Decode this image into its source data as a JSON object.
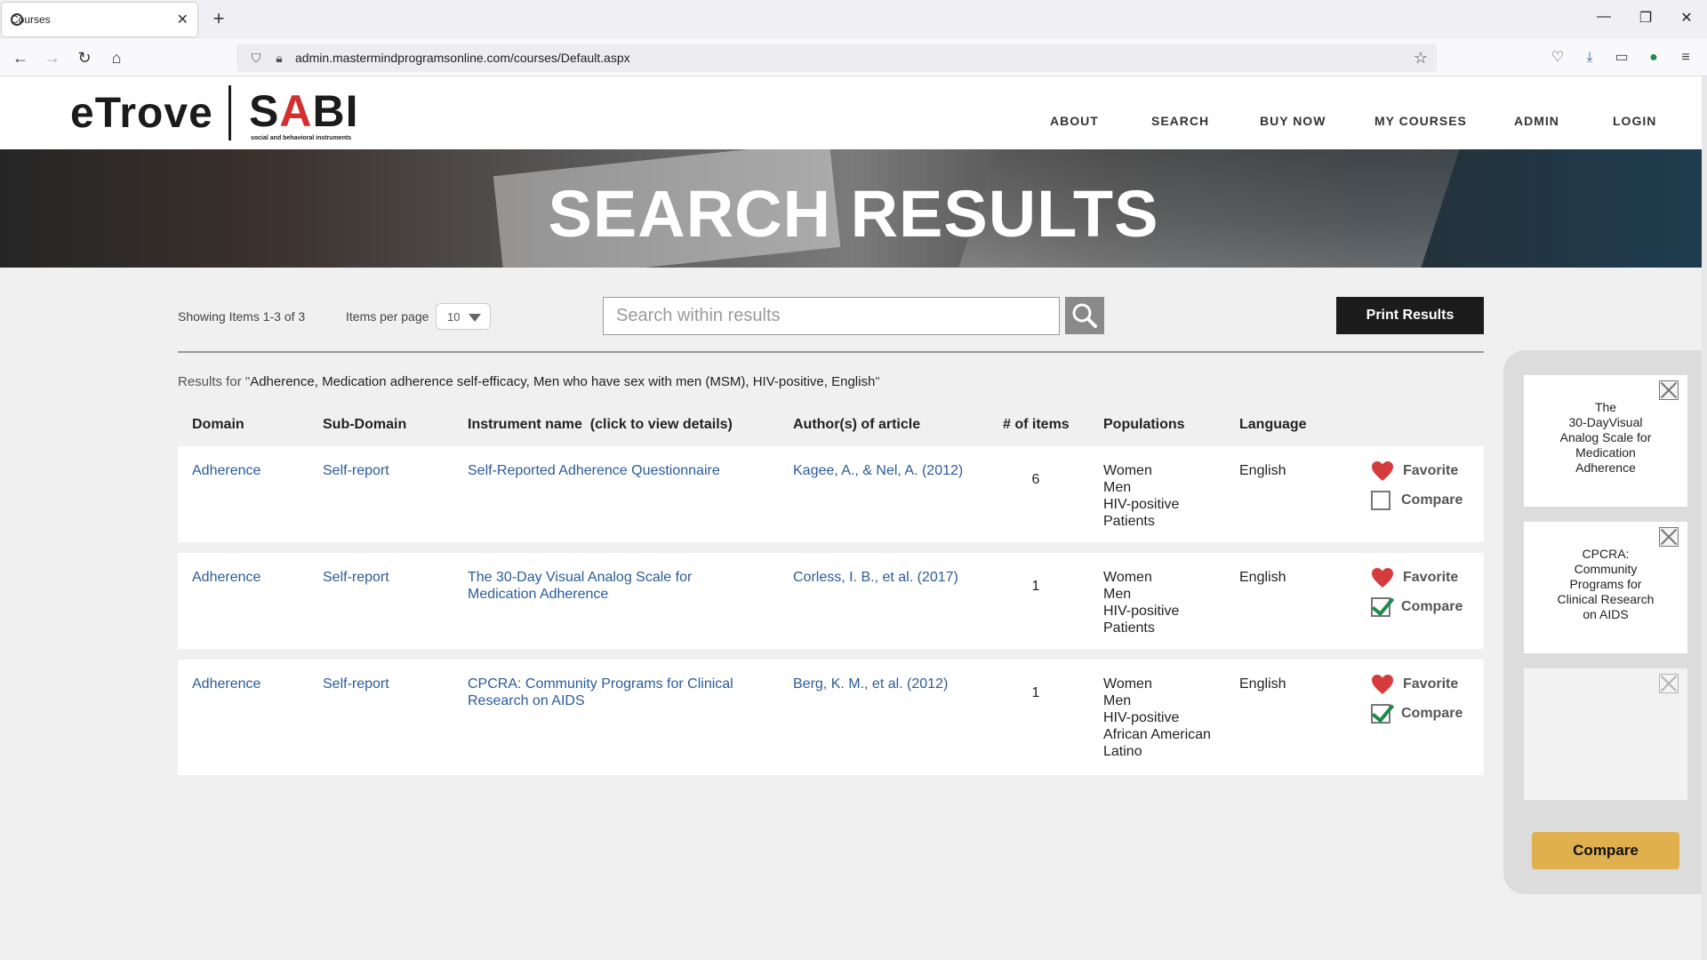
{
  "browser": {
    "tab_title": "Courses",
    "url": "admin.mastermindprogramsonline.com/courses/Default.aspx"
  },
  "site": {
    "logo_left": "eTrove",
    "logo_right_prefix": "S",
    "logo_right_ribbon": "A",
    "logo_right_suffix": "BI",
    "logo_tagline": "social and behavioral instruments",
    "nav": [
      "ABOUT",
      "SEARCH",
      "BUY NOW",
      "MY COURSES",
      "ADMIN",
      "LOGIN"
    ]
  },
  "hero": {
    "title": "SEARCH RESULTS"
  },
  "toolbar": {
    "showing": "Showing Items 1-3 of 3",
    "items_per_page_label": "Items per page",
    "items_per_page_value": "10",
    "search_placeholder": "Search within results",
    "print_label": "Print Results"
  },
  "results_for": {
    "prefix": "Results for \"",
    "query": "Adherence, Medication adherence self-efficacy, Men who have sex with men (MSM), HIV-positive, English",
    "suffix": "\""
  },
  "table": {
    "headers": [
      "Domain",
      "Sub-Domain",
      "Instrument name  (click to view details)",
      "Author(s) of article",
      "# of items",
      "Populations",
      "Language"
    ],
    "rows": [
      {
        "domain": "Adherence",
        "subdomain": "Self-report",
        "instrument_line1": "Self-Reported Adherence Questionnaire",
        "instrument_line2": "",
        "author": "Kagee, A., & Nel, A. (2012)",
        "items": "6",
        "populations": [
          "Women",
          "Men",
          "HIV-positive",
          "Patients"
        ],
        "language": "English",
        "favorite_label": "Favorite",
        "compare_label": "Compare",
        "compare_checked": false
      },
      {
        "domain": "Adherence",
        "subdomain": "Self-report",
        "instrument_line1": "The 30-Day Visual Analog Scale for",
        "instrument_line2": "Medication Adherence",
        "author": "Corless, I. B., et al. (2017)",
        "items": "1",
        "populations": [
          "Women",
          "Men",
          "HIV-positive",
          "Patients"
        ],
        "language": "English",
        "favorite_label": "Favorite",
        "compare_label": "Compare",
        "compare_checked": true
      },
      {
        "domain": "Adherence",
        "subdomain": "Self-report",
        "instrument_line1": "CPCRA: Community Programs for Clinical",
        "instrument_line2": "Research on AIDS",
        "author": "Berg, K. M., et al. (2012)",
        "items": "1",
        "populations": [
          "Women",
          "Men",
          "HIV-positive",
          "African American",
          "Latino"
        ],
        "language": "English",
        "favorite_label": "Favorite",
        "compare_label": "Compare",
        "compare_checked": true
      }
    ]
  },
  "compare_panel": {
    "slots": [
      {
        "lines": [
          "The",
          "30-DayVisual",
          "Analog Scale for",
          "Medication",
          "Adherence"
        ]
      },
      {
        "lines": [
          "CPCRA:",
          "Community",
          "Programs for",
          "Clinical Research",
          "on AIDS"
        ]
      },
      {
        "lines": []
      }
    ],
    "button_label": "Compare"
  },
  "colors": {
    "link": "#2a5c9a",
    "heart": "#d63b3b",
    "check": "#1f8a4c",
    "compare_button": "#e0b04e",
    "print_button": "#1c1c1c"
  }
}
